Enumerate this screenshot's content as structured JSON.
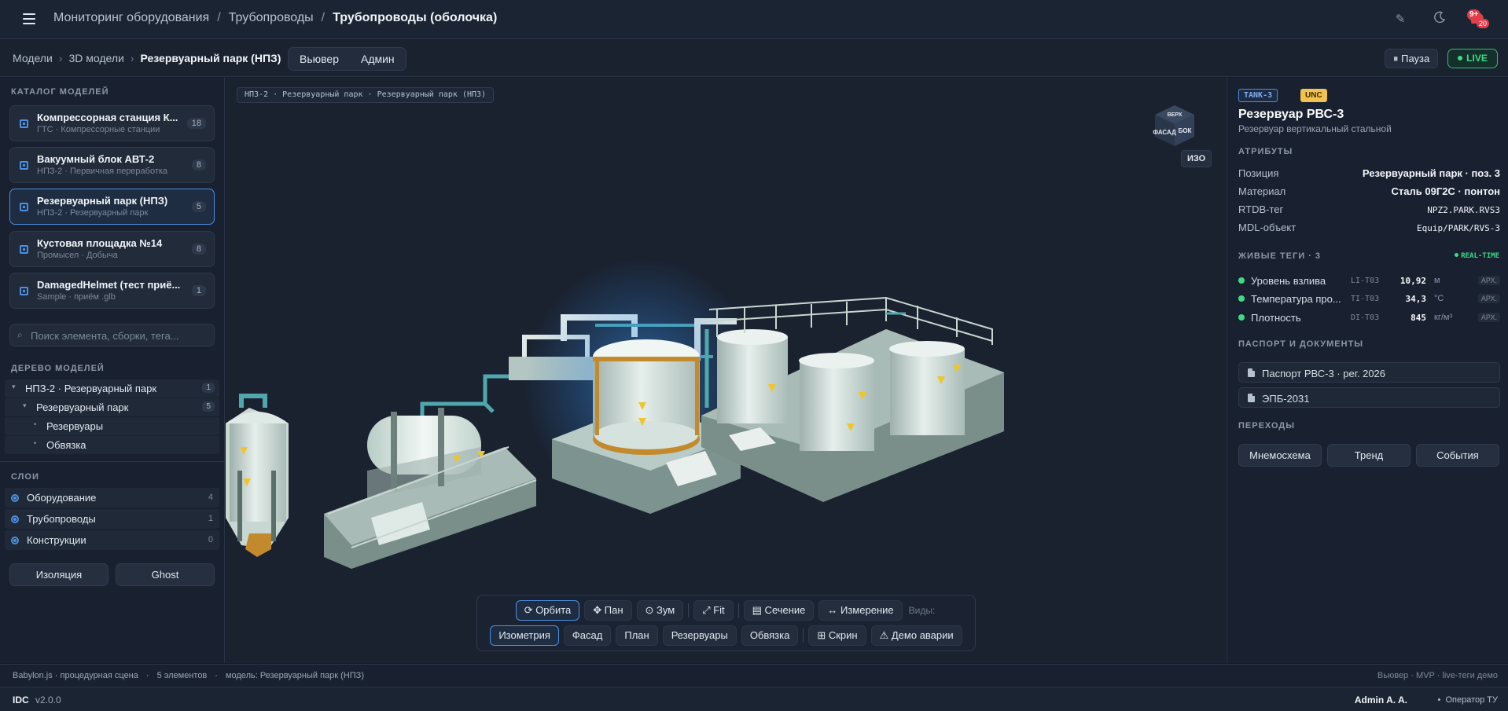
{
  "header": {
    "breadcrumb": [
      "Мониторинг оборудования",
      "Трубопроводы",
      "Трубопроводы (оболочка)"
    ],
    "notif_badge": "9+",
    "notif_count": "20"
  },
  "subbar": {
    "crumbs": [
      "Модели",
      "3D модели",
      "Резервуарный парк (НПЗ)"
    ],
    "modes": [
      "Вьювер",
      "Админ"
    ],
    "pause_label": "⏸ Пауза",
    "live_label": "LIVE"
  },
  "catalog": {
    "title": "КАТАЛОГ МОДЕЛЕЙ",
    "items": [
      {
        "title": "Компрессорная станция К...",
        "sub": "ГТС · Компрессорные станции",
        "count": "18"
      },
      {
        "title": "Вакуумный блок АВТ-2",
        "sub": "НПЗ-2 · Первичная переработка",
        "count": "8"
      },
      {
        "title": "Резервуарный парк (НПЗ)",
        "sub": "НПЗ-2 · Резервуарный парк",
        "count": "5"
      },
      {
        "title": "Кустовая площадка №14",
        "sub": "Промысел · Добыча",
        "count": "8"
      },
      {
        "title": "DamagedHelmet (тест приё...",
        "sub": "Sample · приём .glb",
        "count": "1"
      }
    ],
    "search_placeholder": "Поиск элемента, сборки, тега..."
  },
  "tree": {
    "title": "ДЕРЕВО МОДЕЛЕЙ",
    "rows": [
      {
        "label": "НПЗ-2 · Резервуарный парк",
        "count": "1"
      },
      {
        "label": "Резервуарный парк",
        "count": "5"
      },
      {
        "label": "Резервуары",
        "count": ""
      },
      {
        "label": "Обвязка",
        "count": ""
      }
    ]
  },
  "layers": {
    "title": "СЛОИ",
    "rows": [
      {
        "label": "Оборудование",
        "count": "4"
      },
      {
        "label": "Трубопроводы",
        "count": "1"
      },
      {
        "label": "Конструкции",
        "count": "0"
      }
    ],
    "isolate_label": "Изоляция",
    "ghost_label": "Ghost"
  },
  "viewport": {
    "path": "НПЗ-2 · Резервуарный парк · Резервуарный парк (НПЗ)",
    "cube_top": "ВЕРХ",
    "cube_front": "ФАСАД",
    "cube_side": "БОК",
    "iso_label": "ИЗО",
    "toolbar_row1": {
      "orbit": "⟳ Орбита",
      "pan": "✥ Пан",
      "zoom": "⊙ Зум",
      "fit": "⤢ Fit",
      "section": "▤ Сечение",
      "measure": "↔ Измерение",
      "views_label": "Виды:"
    },
    "toolbar_row2": {
      "isometry": "Изометрия",
      "facade": "Фасад",
      "plan": "План",
      "tanks": "Резервуары",
      "piping": "Обвязка",
      "screenshot": "⊞ Скрин",
      "alarm_demo": "⚠ Демо аварии"
    }
  },
  "details": {
    "tag_id": "TANK-3",
    "tag_status": "UNC",
    "title": "Резервуар РВС-3",
    "subtitle": "Резервуар вертикальный стальной",
    "attrs_title": "АТРИБУТЫ",
    "attrs": [
      {
        "k": "Позиция",
        "v": "Резервуарный парк · поз. 3"
      },
      {
        "k": "Материал",
        "v": "Сталь 09Г2С · понтон"
      },
      {
        "k": "RTDB-тег",
        "v": "NPZ2.PARK.RVS3"
      },
      {
        "k": "MDL-объект",
        "v": "Equip/PARK/RVS-3"
      }
    ],
    "live_title": "ЖИВЫЕ ТЕГИ · 3",
    "realtime_label": "REAL-TIME",
    "live_tags": [
      {
        "name": "Уровень взлива",
        "code": "LI-T03",
        "value": "10,92",
        "unit": "м",
        "arh": "АРХ."
      },
      {
        "name": "Температура про...",
        "code": "TI-T03",
        "value": "34,3",
        "unit": "°C",
        "arh": "АРХ."
      },
      {
        "name": "Плотность",
        "code": "DI-T03",
        "value": "845",
        "unit": "кг/м³",
        "arh": "АРХ."
      }
    ],
    "docs_title": "ПАСПОРТ И ДОКУМЕНТЫ",
    "docs": [
      "Паспорт РВС-3 · рег. 2026",
      "ЭПБ-2031"
    ],
    "nav_title": "ПЕРЕХОДЫ",
    "nav": [
      "Мнемосхема",
      "Тренд",
      "События"
    ]
  },
  "status": {
    "engine": "Babylon.js · процедурная сцена",
    "elements": "5 элементов",
    "model": "модель: Резервуарный парк (НПЗ)",
    "right": "Вьювер · MVP · live-теги демо"
  },
  "footer": {
    "brand": "IDC",
    "version": "v2.0.0",
    "user": "Admin A. A.",
    "role": "Оператор ТУ"
  }
}
